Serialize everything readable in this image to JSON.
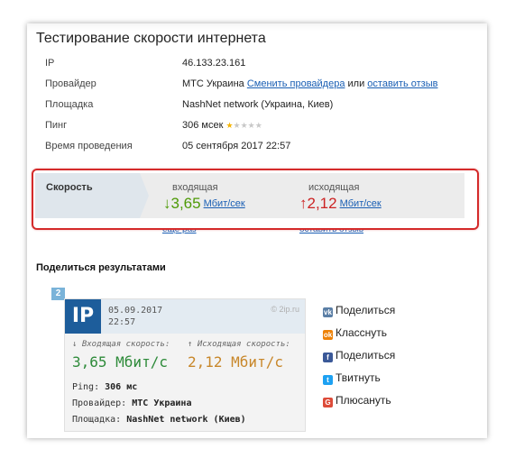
{
  "title": "Тестирование скорости интернета",
  "info": [
    {
      "key": "IP",
      "value": "46.133.23.161"
    },
    {
      "key": "Провайдер",
      "value": "МТС Украина",
      "link1": "Сменить провайдера",
      "sep": "или",
      "link2": "оставить отзыв"
    },
    {
      "key": "Площадка",
      "value": "NashNet network (Украина, Киев)"
    },
    {
      "key": "Пинг",
      "value": "306 мсек"
    },
    {
      "key": "Время проведения",
      "value": "05 сентября 2017 22:57"
    }
  ],
  "ping_rating": {
    "filled": 1,
    "total": 5
  },
  "speed": {
    "label": "Скорость",
    "incoming_label": "входящая",
    "incoming_value": "3,65",
    "outgoing_label": "исходящая",
    "outgoing_value": "2,12",
    "unit": "Мбит/сек"
  },
  "ghost_links": {
    "left": "еще раз",
    "right": "оставить отзыв"
  },
  "share_title": "Поделиться результатами",
  "card": {
    "badge": "2",
    "logo": "IP",
    "date": "05.09.2017",
    "time": "22:57",
    "site": "© 2ip.ru",
    "incoming_label": "↓ Входящая скорость:",
    "incoming_value": "3,65 Мбит/с",
    "outgoing_label": "↑ Исходящая скорость:",
    "outgoing_value": "2,12 Мбит/с",
    "ping_label": "Ping:",
    "ping_value": "306 мс",
    "provider_label": "Провайдер:",
    "provider_value": "МТС Украина",
    "site_label": "Площадка:",
    "site_value": "NashNet network (Киев)"
  },
  "share_buttons": [
    {
      "icon": "vk-icon",
      "glyph": "vk",
      "color": "#5b7fa6",
      "label": "Поделиться"
    },
    {
      "icon": "odnoklassniki-icon",
      "glyph": "ok",
      "color": "#ee8208",
      "label": "Класснуть"
    },
    {
      "icon": "facebook-icon",
      "glyph": "f",
      "color": "#3b5998",
      "label": "Поделиться"
    },
    {
      "icon": "twitter-icon",
      "glyph": "t",
      "color": "#1da1f2",
      "label": "Твитнуть"
    },
    {
      "icon": "google-plus-icon",
      "glyph": "G",
      "color": "#dd4b39",
      "label": "Плюсануть"
    }
  ],
  "colors": {
    "accent_link": "#1a5fb4",
    "incoming": "#4e9a06",
    "outgoing": "#cc2222",
    "highlight_frame": "#d42a2a"
  }
}
